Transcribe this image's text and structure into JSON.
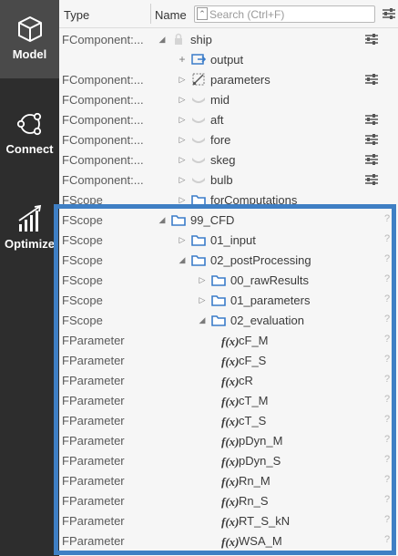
{
  "sidebar": {
    "items": [
      {
        "label": "Model",
        "icon": "cube-icon",
        "active": true
      },
      {
        "label": "Connect",
        "icon": "connect-icon",
        "active": false
      },
      {
        "label": "Optimize",
        "icon": "optimize-icon",
        "active": false
      }
    ]
  },
  "header": {
    "type_label": "Type",
    "name_label": "Name",
    "search_placeholder": "Search (Ctrl+F)"
  },
  "rows": [
    {
      "type": "FComponent:...",
      "name": "ship",
      "level": 0,
      "arrow": "open",
      "icon": "lock-icon",
      "right_button": true,
      "help": false
    },
    {
      "type": "",
      "name": "output",
      "level": 1,
      "arrow": "plus",
      "icon": "output-icon",
      "right_button": false,
      "help": false
    },
    {
      "type": "FComponent:...",
      "name": "parameters",
      "level": 1,
      "arrow": "closed",
      "icon": "parameters-icon",
      "right_button": true,
      "help": false
    },
    {
      "type": "FComponent:...",
      "name": "mid",
      "level": 1,
      "arrow": "closed",
      "icon": "hull-icon",
      "right_button": false,
      "help": false
    },
    {
      "type": "FComponent:...",
      "name": "aft",
      "level": 1,
      "arrow": "closed",
      "icon": "hull-icon",
      "right_button": true,
      "help": false
    },
    {
      "type": "FComponent:...",
      "name": "fore",
      "level": 1,
      "arrow": "closed",
      "icon": "hull-icon",
      "right_button": true,
      "help": false
    },
    {
      "type": "FComponent:...",
      "name": "skeg",
      "level": 1,
      "arrow": "closed",
      "icon": "hull-icon",
      "right_button": true,
      "help": false
    },
    {
      "type": "FComponent:...",
      "name": "bulb",
      "level": 1,
      "arrow": "closed",
      "icon": "hull-icon",
      "right_button": true,
      "help": false
    },
    {
      "type": "FScope",
      "name": "forComputations",
      "level": 1,
      "arrow": "closed",
      "icon": "folder-icon",
      "right_button": false,
      "help": false
    },
    {
      "type": "FScope",
      "name": "99_CFD",
      "level": 0,
      "arrow": "open",
      "icon": "folder-icon",
      "right_button": false,
      "help": true
    },
    {
      "type": "FScope",
      "name": "01_input",
      "level": 1,
      "arrow": "closed",
      "icon": "folder-icon",
      "right_button": false,
      "help": true
    },
    {
      "type": "FScope",
      "name": "02_postProcessing",
      "level": 1,
      "arrow": "open",
      "icon": "folder-icon",
      "right_button": false,
      "help": true
    },
    {
      "type": "FScope",
      "name": "00_rawResults",
      "level": 2,
      "arrow": "closed",
      "icon": "folder-icon",
      "right_button": false,
      "help": true
    },
    {
      "type": "FScope",
      "name": "01_parameters",
      "level": 2,
      "arrow": "closed",
      "icon": "folder-icon",
      "right_button": false,
      "help": true
    },
    {
      "type": "FScope",
      "name": "02_evaluation",
      "level": 2,
      "arrow": "open",
      "icon": "folder-icon",
      "right_button": false,
      "help": true
    },
    {
      "type": "FParameter",
      "name": "cF_M",
      "level": 3,
      "arrow": "none",
      "icon": "fx",
      "right_button": false,
      "help": true
    },
    {
      "type": "FParameter",
      "name": "cF_S",
      "level": 3,
      "arrow": "none",
      "icon": "fx",
      "right_button": false,
      "help": true
    },
    {
      "type": "FParameter",
      "name": "cR",
      "level": 3,
      "arrow": "none",
      "icon": "fx",
      "right_button": false,
      "help": true
    },
    {
      "type": "FParameter",
      "name": "cT_M",
      "level": 3,
      "arrow": "none",
      "icon": "fx",
      "right_button": false,
      "help": true
    },
    {
      "type": "FParameter",
      "name": "cT_S",
      "level": 3,
      "arrow": "none",
      "icon": "fx",
      "right_button": false,
      "help": true
    },
    {
      "type": "FParameter",
      "name": "pDyn_M",
      "level": 3,
      "arrow": "none",
      "icon": "fx",
      "right_button": false,
      "help": true
    },
    {
      "type": "FParameter",
      "name": "pDyn_S",
      "level": 3,
      "arrow": "none",
      "icon": "fx",
      "right_button": false,
      "help": true
    },
    {
      "type": "FParameter",
      "name": "Rn_M",
      "level": 3,
      "arrow": "none",
      "icon": "fx",
      "right_button": false,
      "help": true
    },
    {
      "type": "FParameter",
      "name": "Rn_S",
      "level": 3,
      "arrow": "none",
      "icon": "fx",
      "right_button": false,
      "help": true
    },
    {
      "type": "FParameter",
      "name": "RT_S_kN",
      "level": 3,
      "arrow": "none",
      "icon": "fx",
      "right_button": false,
      "help": true
    },
    {
      "type": "FParameter",
      "name": "WSA_M",
      "level": 3,
      "arrow": "none",
      "icon": "fx",
      "right_button": false,
      "help": true
    }
  ],
  "fx_label": "f(x)",
  "help_mark": "?",
  "colors": {
    "accent": "#3f7fc4",
    "folder": "#3a7cc9",
    "rail": "#2d2d2d",
    "rail_active": "#4a4a4a"
  }
}
